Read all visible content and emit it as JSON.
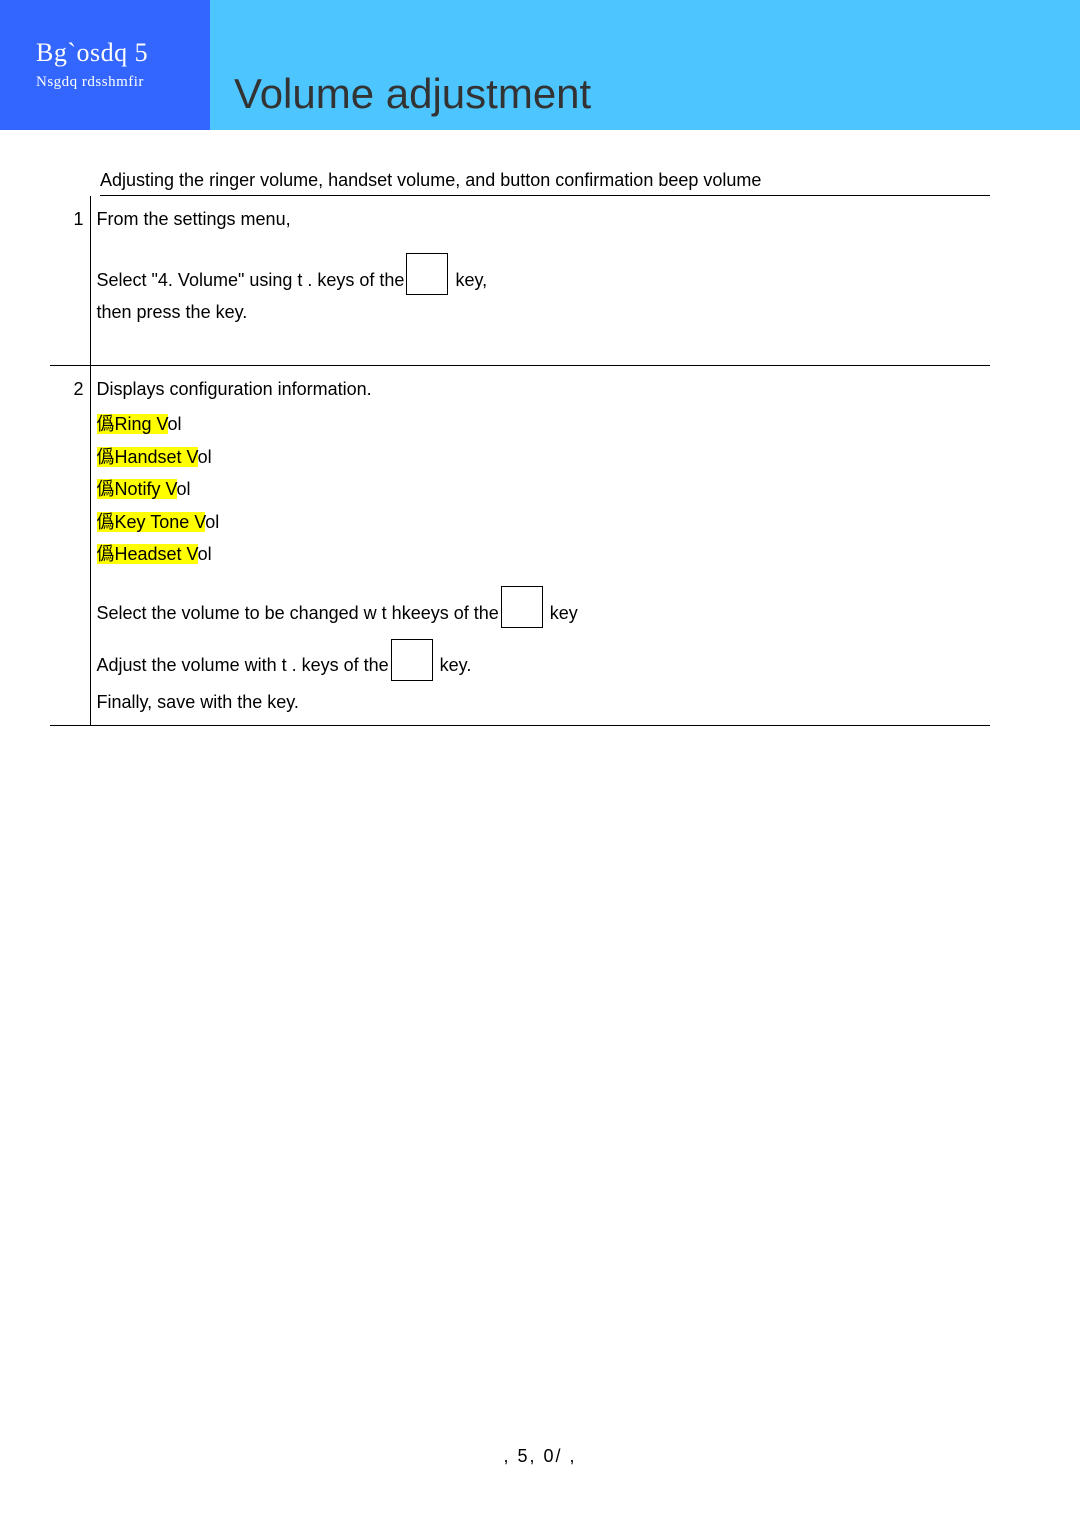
{
  "header": {
    "chapter_label": "Bg`osdq 5",
    "chapter_sub": "Nsgdq rdsshmfir",
    "page_title": "Volume adjustment"
  },
  "intro": "Adjusting the ringer volume, handset volume, and button confirmation beep volume",
  "steps": {
    "s1": {
      "num": "1",
      "line1": "From the settings menu,",
      "line2a": "Select \"4. Volume\"  using  t .  keys of the",
      "line2b": " key,",
      "line3": "then press the  key."
    },
    "s2": {
      "num": "2",
      "line1": "Displays configuration information.",
      "cfg_prefix": "僞",
      "cfg1": "Ring V",
      "cfg1_tail": "ol",
      "cfg2": "Handset V",
      "cfg2_tail": "ol",
      "cfg3": "Notify V",
      "cfg3_tail": "ol",
      "cfg4": "Key Tone V",
      "cfg4_tail": "ol",
      "cfg5": "Headset V",
      "cfg5_tail": "ol",
      "line_sel_a": "Select the volume to be changed w  t  hkeeys of the",
      "line_sel_b": " key",
      "line_adj_a": "Adjust the volume with  t .  keys of the",
      "line_adj_b": " key.",
      "line_save": "Finally, save with the  key."
    }
  },
  "footer": ",   5, 0/  ,"
}
